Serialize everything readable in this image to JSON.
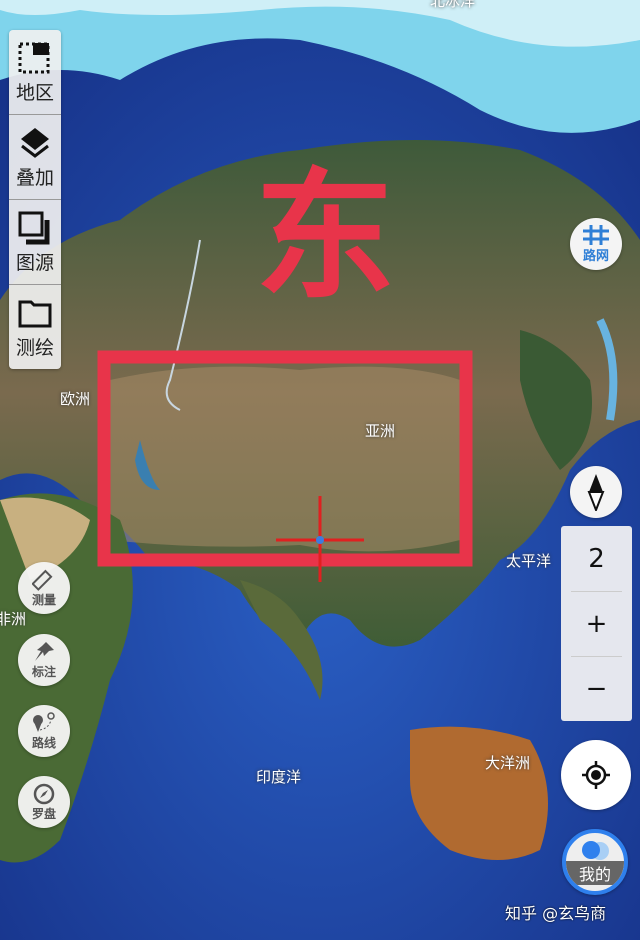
{
  "map": {
    "labels": {
      "arctic": "北冰洋",
      "europe": "欧洲",
      "asia": "亚洲",
      "africa": "非洲",
      "indian_ocean": "印度洋",
      "oceania": "大洋洲",
      "pacific": "太平洋"
    },
    "annotation_text": "东",
    "annotation_color": "#e8344a",
    "crosshair_color": "#e02020"
  },
  "layer_panel": [
    {
      "label": "地区",
      "icon": "region-icon"
    },
    {
      "label": "叠加",
      "icon": "layers-icon"
    },
    {
      "label": "图源",
      "icon": "map-source-icon"
    },
    {
      "label": "测绘",
      "icon": "folder-icon"
    }
  ],
  "tools": [
    {
      "label": "测量",
      "icon": "ruler-icon"
    },
    {
      "label": "标注",
      "icon": "pin-icon"
    },
    {
      "label": "路线",
      "icon": "route-icon"
    },
    {
      "label": "罗盘",
      "icon": "compass-icon"
    }
  ],
  "road_network": {
    "label": "路网",
    "color": "#2f7fd6"
  },
  "zoom": {
    "level": "2",
    "plus": "+",
    "minus": "−"
  },
  "my": {
    "label": "我的",
    "accent": "#2f80ed"
  },
  "watermark": "知乎 @玄鸟商"
}
